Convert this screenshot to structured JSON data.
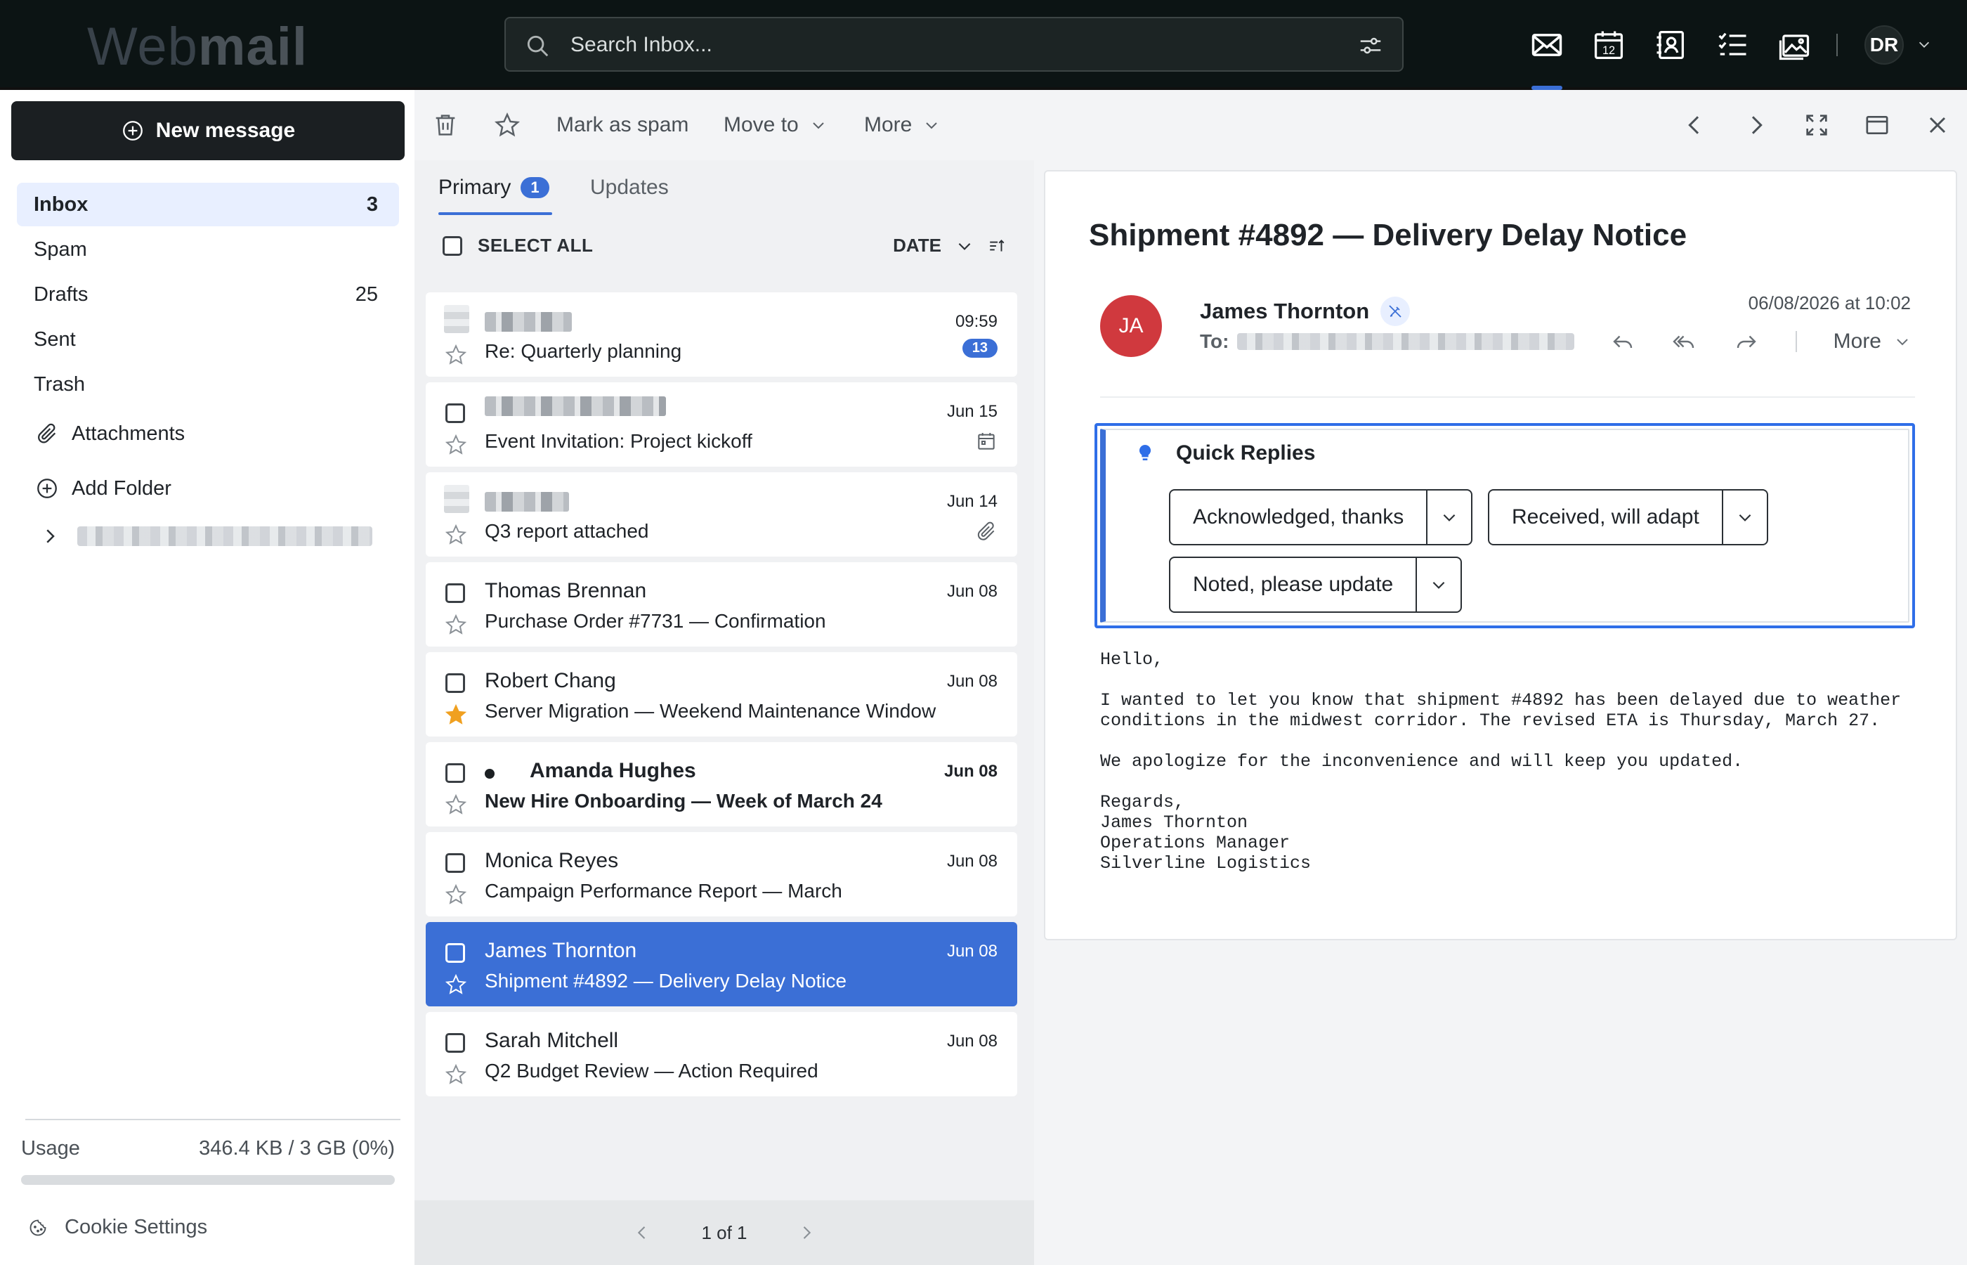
{
  "app": {
    "logo_light": "Web",
    "logo_bold": "mail",
    "search_placeholder": "Search Inbox...",
    "user_initials": "DR",
    "top_icons": [
      "mail-icon",
      "calendar-icon",
      "contacts-icon",
      "tasks-icon",
      "photos-icon"
    ],
    "calendar_day": "12"
  },
  "sidebar": {
    "new_message": "New message",
    "folders": [
      {
        "label": "Inbox",
        "count": "3"
      },
      {
        "label": "Spam",
        "count": ""
      },
      {
        "label": "Drafts",
        "count": "25"
      },
      {
        "label": "Sent",
        "count": ""
      },
      {
        "label": "Trash",
        "count": ""
      }
    ],
    "attachments": "Attachments",
    "add_folder": "Add Folder",
    "usage_label": "Usage",
    "usage_value": "346.4 KB / 3 GB (0%)",
    "usage_fraction": 0.0,
    "cookie": "Cookie Settings"
  },
  "toolbar": {
    "mark_spam": "Mark as spam",
    "move_to": "Move to",
    "more": "More"
  },
  "list": {
    "tabs": [
      {
        "label": "Primary",
        "badge": "1"
      },
      {
        "label": "Updates"
      }
    ],
    "select_all": "SELECT ALL",
    "sort_label": "DATE",
    "items": [
      {
        "sender": "",
        "subject": "Re: Quarterly planning",
        "date": "09:59",
        "thread_count": "13"
      },
      {
        "sender": "",
        "subject": "Event Invitation: Project kickoff",
        "date": "Jun 15"
      },
      {
        "sender": "",
        "subject": "Q3 report attached",
        "date": "Jun 14"
      },
      {
        "sender": "Thomas Brennan",
        "subject": "Purchase Order #7731 — Confirmation",
        "date": "Jun 08"
      },
      {
        "sender": "Robert Chang",
        "subject": "Server Migration — Weekend Maintenance Window",
        "date": "Jun 08",
        "starred": true
      },
      {
        "sender": "Amanda Hughes",
        "subject": "New Hire Onboarding — Week of March 24",
        "date": "Jun 08",
        "unread": true
      },
      {
        "sender": "Monica Reyes",
        "subject": "Campaign Performance Report — March",
        "date": "Jun 08"
      },
      {
        "sender": "James Thornton",
        "subject": "Shipment #4892 — Delivery Delay Notice",
        "date": "Jun 08",
        "selected": true
      },
      {
        "sender": "Sarah Mitchell",
        "subject": "Q2 Budget Review — Action Required",
        "date": "Jun 08"
      }
    ],
    "pagination": "1 of 1"
  },
  "reader": {
    "title": "Shipment #4892 — Delivery Delay Notice",
    "avatar_initials": "JA",
    "from_name": "James Thornton",
    "to_label": "To:",
    "date": "06/08/2026 at 10:02",
    "more": "More",
    "quick_replies_title": "Quick Replies",
    "quick_replies": [
      "Acknowledged, thanks",
      "Received, will adapt",
      "Noted, please update"
    ],
    "body": "Hello,\n\nI wanted to let you know that shipment #4892 has been delayed due to weather\nconditions in the midwest corridor. The revised ETA is Thursday, March 27.\n\nWe apologize for the inconvenience and will keep you updated.\n\nRegards,\nJames Thornton\nOperations Manager\nSilverline Logistics"
  },
  "colors": {
    "accent": "#3b6fd6",
    "topbar": "#0c1414",
    "avatar": "#d0393e",
    "star": "#f0a020"
  }
}
